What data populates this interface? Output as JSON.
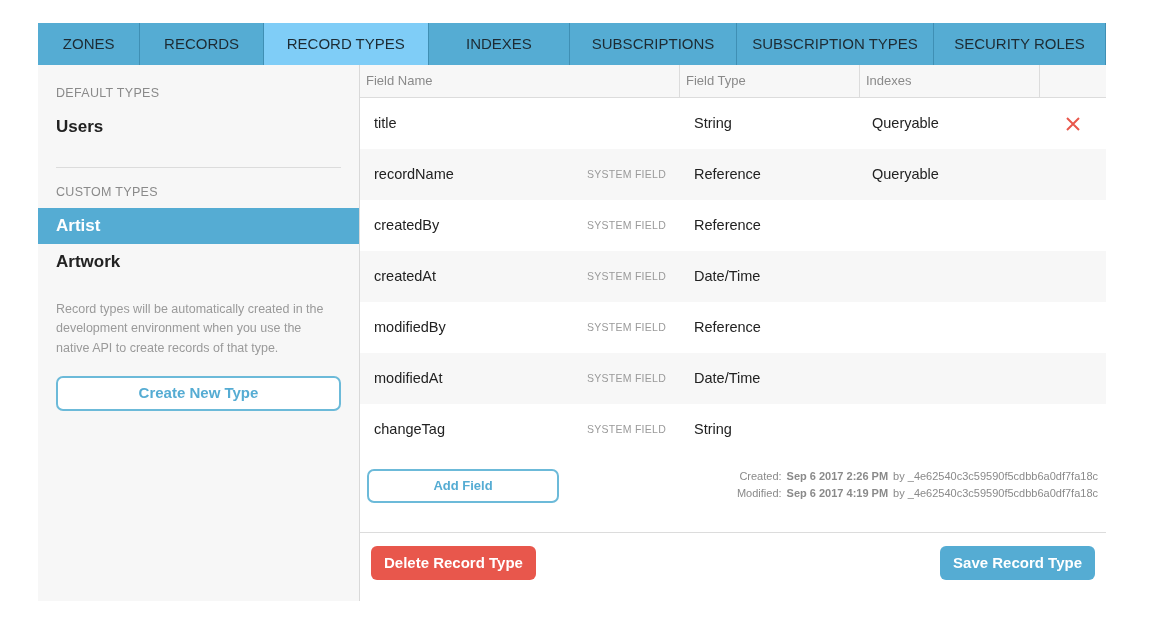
{
  "tabs": [
    {
      "label": "ZONES",
      "selected": false
    },
    {
      "label": "RECORDS",
      "selected": false
    },
    {
      "label": "RECORD TYPES",
      "selected": true
    },
    {
      "label": "INDEXES",
      "selected": false
    },
    {
      "label": "SUBSCRIPTIONS",
      "selected": false
    },
    {
      "label": "SUBSCRIPTION TYPES",
      "selected": false
    },
    {
      "label": "SECURITY ROLES",
      "selected": false
    }
  ],
  "sidebar": {
    "sections": [
      {
        "heading": "DEFAULT TYPES",
        "items": [
          {
            "label": "Users",
            "selected": false
          }
        ]
      },
      {
        "heading": "CUSTOM TYPES",
        "items": [
          {
            "label": "Artist",
            "selected": true
          },
          {
            "label": "Artwork",
            "selected": false
          }
        ]
      }
    ],
    "note": "Record types will be automatically created in the development environment when you use the native API to create records of that type.",
    "create_button": "Create New Type"
  },
  "table": {
    "columns": [
      "Field Name",
      "Field Type",
      "Indexes"
    ],
    "rows": [
      {
        "name": "title",
        "type": "String",
        "indexes": "Queryable",
        "deletable": true
      },
      {
        "name": "recordName",
        "tag": "SYSTEM FIELD",
        "type": "Reference",
        "indexes": "Queryable",
        "deletable": false
      },
      {
        "name": "createdBy",
        "tag": "SYSTEM FIELD",
        "type": "Reference",
        "deletable": false
      },
      {
        "name": "createdAt",
        "tag": "SYSTEM FIELD",
        "type": "Date/Time",
        "deletable": false
      },
      {
        "name": "modifiedBy",
        "tag": "SYSTEM FIELD",
        "type": "Reference",
        "deletable": false
      },
      {
        "name": "modifiedAt",
        "tag": "SYSTEM FIELD",
        "type": "Date/Time",
        "deletable": false
      },
      {
        "name": "changeTag",
        "tag": "SYSTEM FIELD",
        "type": "String",
        "deletable": false
      }
    ]
  },
  "add_field_button": "Add Field",
  "meta": [
    {
      "label": "Created:",
      "date": "Sep 6 2017 2:26 PM",
      "by": "by _4e62540c3c59590f5cdbb6a0df7fa18c"
    },
    {
      "label": "Modified:",
      "date": "Sep 6 2017 4:19 PM",
      "by": "by _4e62540c3c59590f5cdbb6a0df7fa18c"
    }
  ],
  "delete_button": "Delete Record Type",
  "save_button": "Save Record Type"
}
